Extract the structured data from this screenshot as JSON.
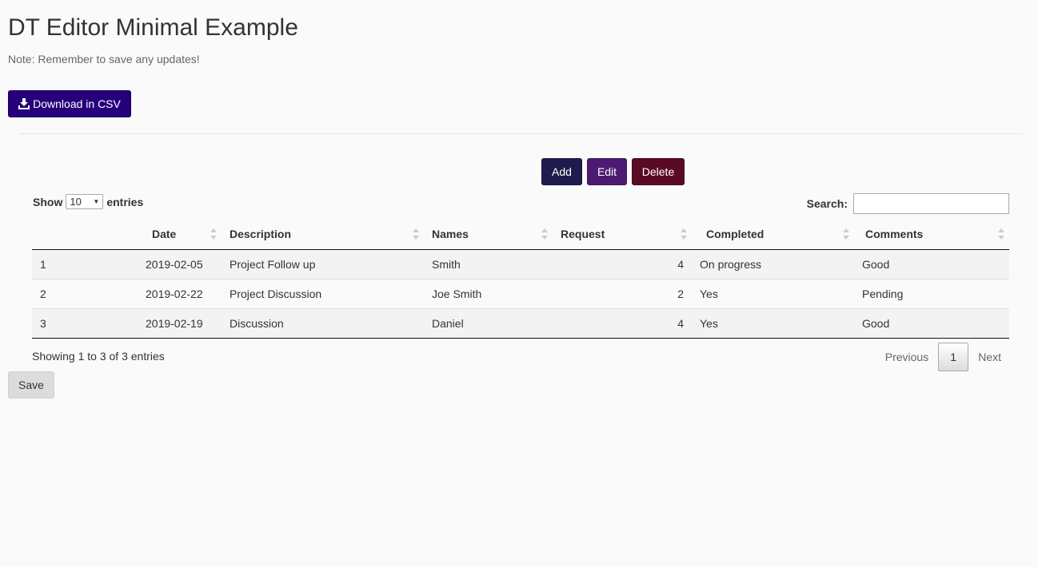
{
  "page": {
    "title": "DT Editor Minimal Example",
    "note": "Note: Remember to save any updates!"
  },
  "toolbar": {
    "download_label": "Download in CSV",
    "download_icon": "download-icon",
    "download_color": "#26007b"
  },
  "editor_buttons": {
    "add": "Add",
    "edit": "Edit",
    "delete": "Delete",
    "add_color": "#1f1b4d",
    "edit_color": "#4e1a71",
    "delete_color": "#5a0b24"
  },
  "length": {
    "prefix": "Show",
    "value": "10",
    "suffix": "entries"
  },
  "search": {
    "label": "Search:",
    "value": ""
  },
  "table": {
    "columns": [
      "",
      "Date",
      "Description",
      "Names",
      "Request",
      "Completed",
      "Comments"
    ],
    "rows": [
      [
        "1",
        "2019-02-05",
        "Project Follow up",
        "Smith",
        "4",
        "On progress",
        "Good"
      ],
      [
        "2",
        "2019-02-22",
        "Project Discussion",
        "Joe Smith",
        "2",
        "Yes",
        "Pending"
      ],
      [
        "3",
        "2019-02-19",
        "Discussion",
        "Daniel",
        "4",
        "Yes",
        "Good"
      ]
    ]
  },
  "footer": {
    "info": "Showing 1 to 3 of 3 entries",
    "previous": "Previous",
    "current_page": "1",
    "next": "Next"
  },
  "save_label": "Save"
}
